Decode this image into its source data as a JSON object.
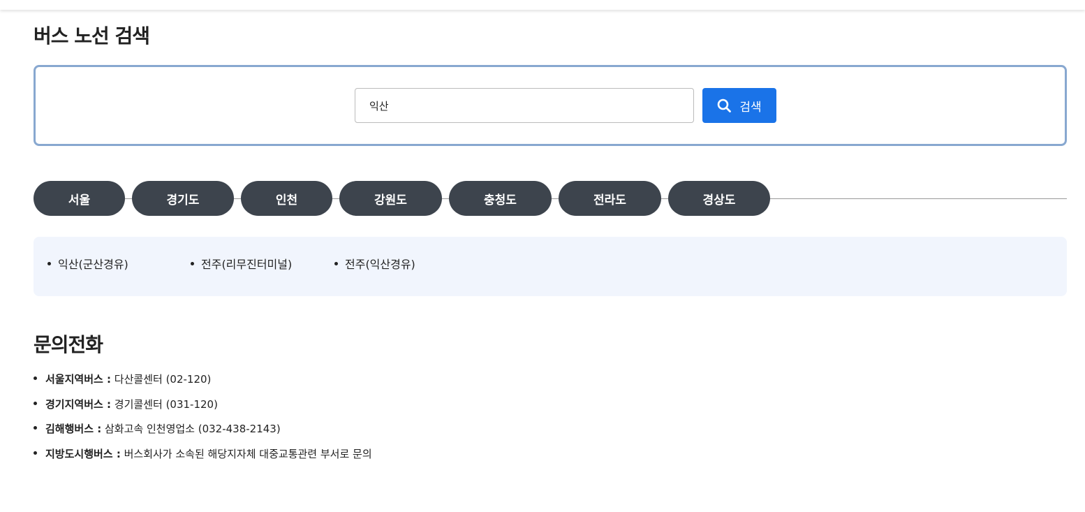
{
  "page": {
    "title": "버스 노선 검색"
  },
  "search": {
    "value": "익산",
    "button_label": "검색"
  },
  "region_tabs": [
    "서울",
    "경기도",
    "인천",
    "강원도",
    "충청도",
    "전라도",
    "경상도"
  ],
  "routes": [
    "익산(군산경유)",
    "전주(리무진터미널)",
    "전주(익산경유)"
  ],
  "contact": {
    "title": "문의전화",
    "items": [
      {
        "label": "서울지역버스 :",
        "value": " 다산콜센터 (02-120)"
      },
      {
        "label": "경기지역버스 :",
        "value": " 경기콜센터 (031-120)"
      },
      {
        "label": "김해행버스 :",
        "value": " 삼화고속 인천영업소 (032-438-2143)"
      },
      {
        "label": "지방도시행버스 :",
        "value": " 버스회사가 소속된 해당지자체 대중교통관련 부서로 문의"
      }
    ]
  },
  "colors": {
    "accent": "#1a73e8",
    "tab_bg": "#3d444d",
    "search_border": "#88a8d0",
    "panel_bg": "#f1f5fd"
  },
  "icons": {
    "search_button": "search-icon"
  }
}
